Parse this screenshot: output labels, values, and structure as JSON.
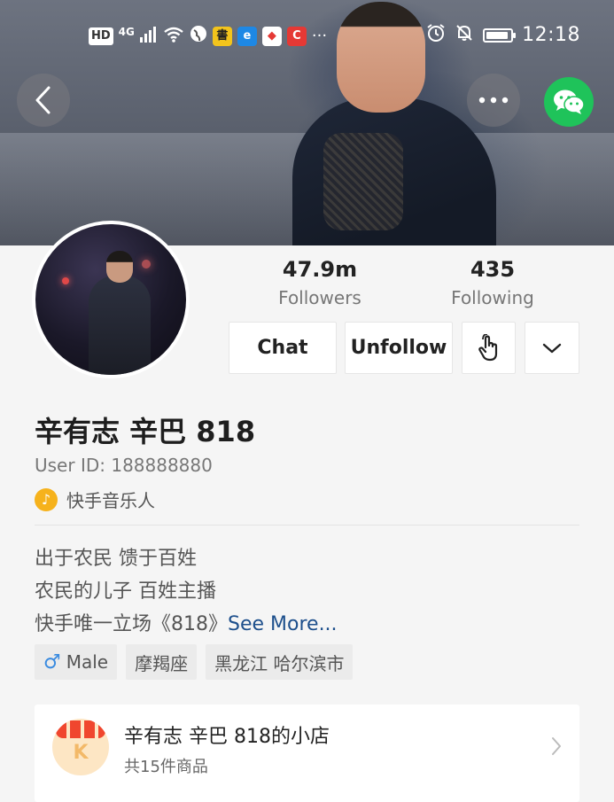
{
  "status_bar": {
    "hd": "HD",
    "network": "4G",
    "dots": "···",
    "time": "12:18",
    "app_icons": [
      {
        "name": "book-app",
        "glyph": "書",
        "bg": "#f3c41c",
        "fg": "#222"
      },
      {
        "name": "browser-app",
        "glyph": "e",
        "bg": "#1e88e5",
        "fg": "#fff"
      },
      {
        "name": "game-app",
        "glyph": "◆",
        "bg": "#ffffff",
        "fg": "#e53935"
      },
      {
        "name": "c-app",
        "glyph": "C",
        "bg": "#e53935",
        "fg": "#fff"
      }
    ]
  },
  "profile": {
    "followers_value": "47.9m",
    "followers_label": "Followers",
    "following_value": "435",
    "following_label": "Following",
    "display_name": "辛有志 辛巴 818",
    "user_id": "User ID: 188888880",
    "badge_label": "快手音乐人",
    "bio_lines": [
      "出于农民 馈于百姓",
      "农民的儿子  百姓主播",
      "快手唯一立场《818》"
    ],
    "see_more": "See More..."
  },
  "actions": {
    "chat_label": "Chat",
    "unfollow_label": "Unfollow"
  },
  "tags": {
    "gender": "Male",
    "zodiac": "摩羯座",
    "location": "黑龙江 哈尔滨市"
  },
  "shop": {
    "title": "辛有志 辛巴 818的小店",
    "subtitle": "共15件商品",
    "logo_letter": "K"
  },
  "colors": {
    "wechat": "#1fc35a",
    "link": "#1d4f8c",
    "badge": "#f6b21c",
    "male": "#3a8be0"
  }
}
